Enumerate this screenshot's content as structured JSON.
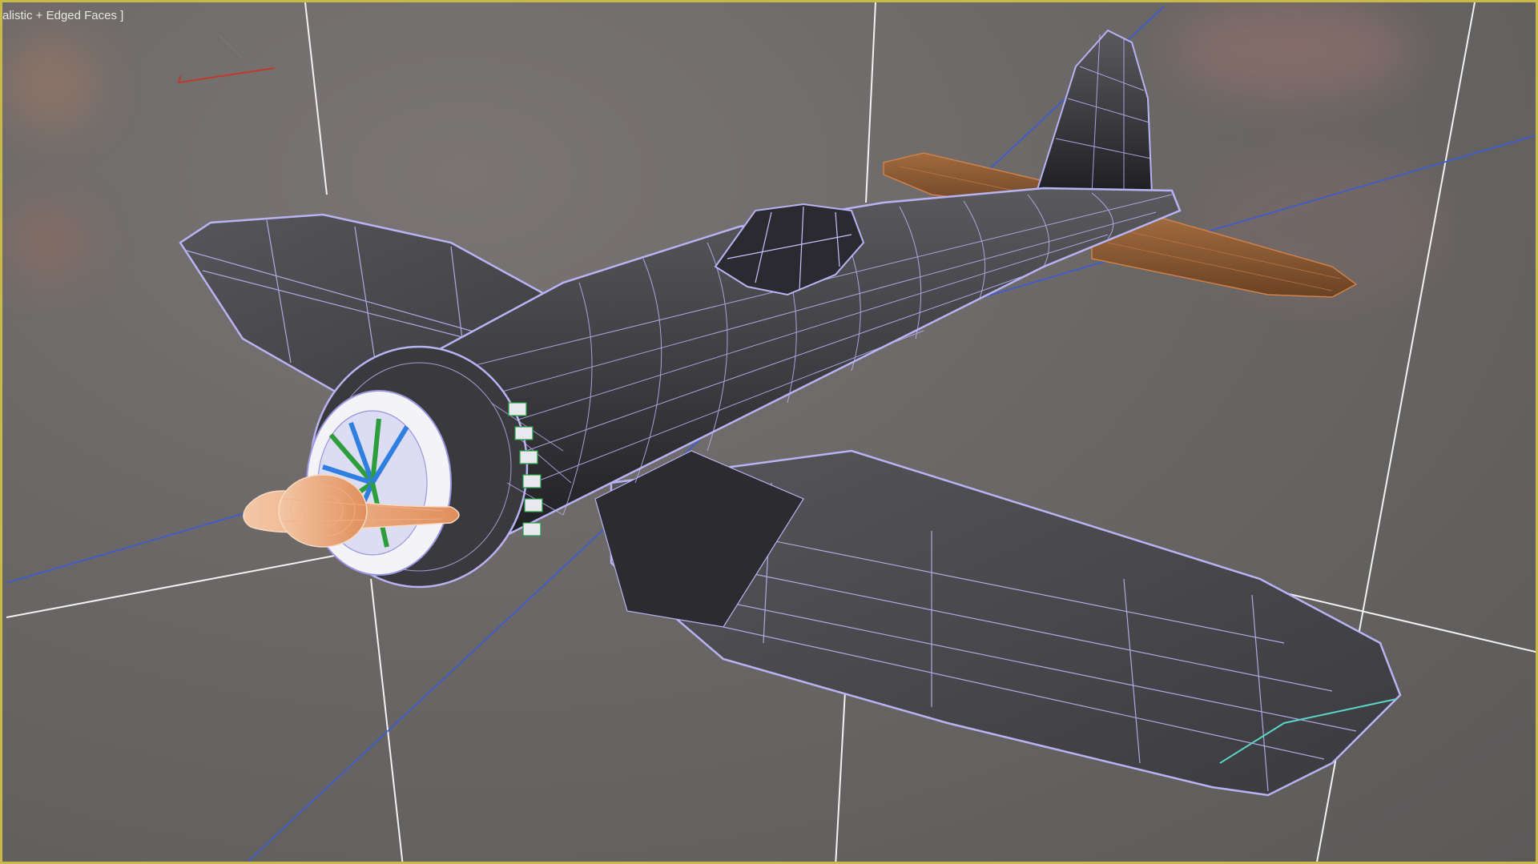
{
  "viewport": {
    "label": "alistic + Edged Faces ]",
    "border_color": "#c9b84a",
    "background_color": "#6a6766"
  },
  "gizmo": {
    "name": "view-axis-gizmo",
    "x_axis_color": "#c0392b"
  },
  "model": {
    "name": "fighter-plane-model",
    "body_color": "#3c3c3e",
    "wire_color": "#b8b4f4",
    "tail_color": "#8a5a36",
    "propeller_color": "#e8a37a",
    "engine_fan_colors": [
      "#2f7fe0",
      "#2e9e3c",
      "#ffffff"
    ]
  },
  "grid": {
    "line_color": "#f2f2f2",
    "axis_color": "#3a5bd9"
  }
}
